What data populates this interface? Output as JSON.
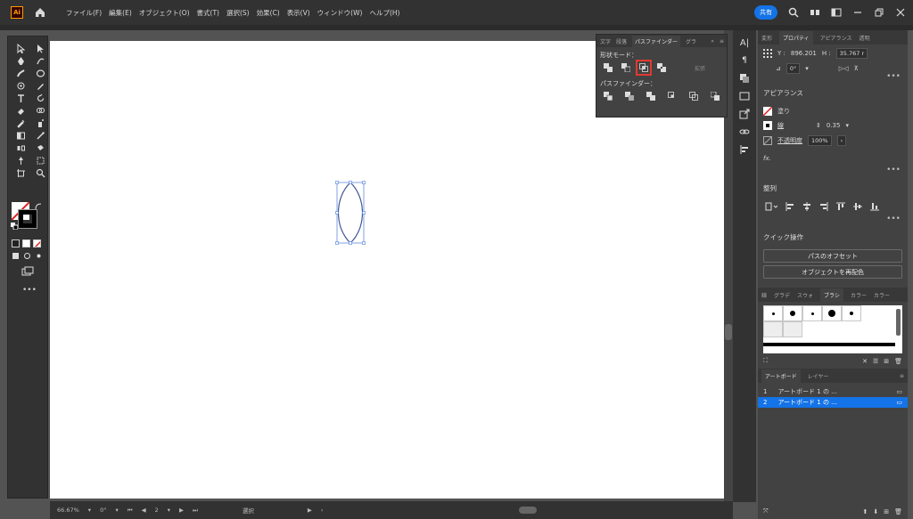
{
  "app": {
    "logo": "Ai",
    "share": "共有"
  },
  "menu": [
    "ファイル(F)",
    "編集(E)",
    "オブジェクト(O)",
    "書式(T)",
    "選択(S)",
    "効果(C)",
    "表示(V)",
    "ウィンドウ(W)",
    "ヘルプ(H)"
  ],
  "pathfinder": {
    "tabs": [
      "文字",
      "段落",
      "パスファインダー",
      "グラ"
    ],
    "shape_modes_label": "形状モード：",
    "expand_label": "拡張",
    "pathfinders_label": "パスファインダー："
  },
  "properties": {
    "tabs": [
      "変形",
      "プロパティ",
      "アピアランス",
      "透明"
    ],
    "y_label": "Y :",
    "y_value": "896.201",
    "h_label": "H :",
    "h_value": "35.767 r",
    "angle_value": "0°",
    "appearance_title": "アピアランス",
    "fill_label": "塗り",
    "stroke_label": "線",
    "stroke_value": "0.35",
    "opacity_label": "不透明度",
    "opacity_value": "100%",
    "fx_label": "fx.",
    "align_title": "整列",
    "quick_actions_title": "クイック操作",
    "offset_path_button": "パスのオフセット",
    "recolor_button": "オブジェクトを再配色"
  },
  "brushes": {
    "tabs": [
      "線",
      "グラデ",
      "スウォ",
      "ブラシ",
      "カラー",
      "カラー"
    ]
  },
  "layers": {
    "tabs": [
      "アートボード",
      "レイヤー"
    ],
    "rows": [
      {
        "num": "1",
        "name": "アートボード 1 の ..."
      },
      {
        "num": "2",
        "name": "アートボード 1 の ..."
      }
    ]
  },
  "status": {
    "zoom": "66.67%",
    "rotation": "0°",
    "page": "2",
    "tool": "選択"
  },
  "colors": {
    "accent": "#1473e6",
    "highlight": "#e03a2f",
    "selection": "#4a7bd8"
  }
}
